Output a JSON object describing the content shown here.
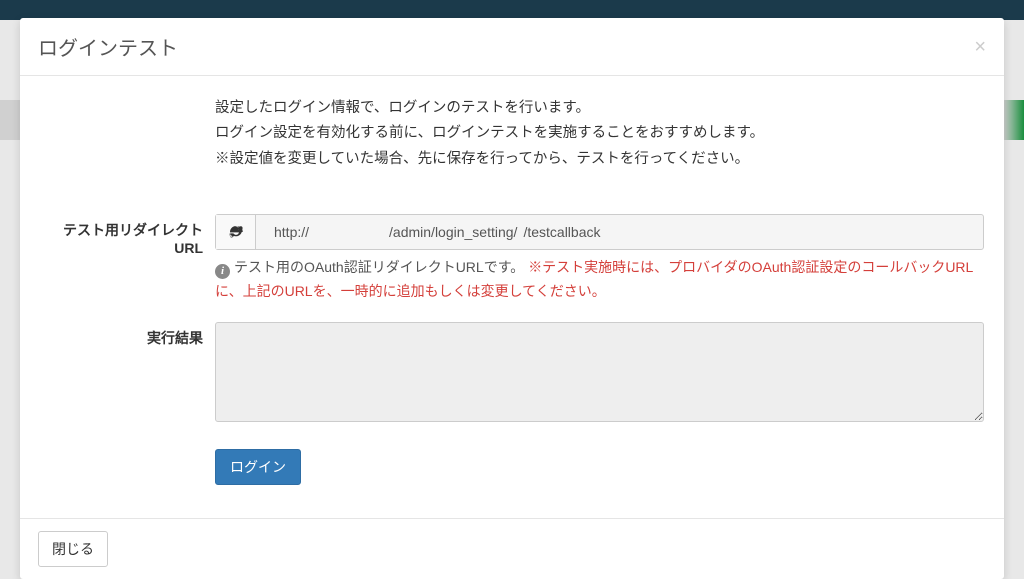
{
  "modal": {
    "title": "ログインテスト",
    "close_x": "×",
    "intro": {
      "line1": "設定したログイン情報で、ログインのテストを行います。",
      "line2": "ログイン設定を有効化する前に、ログインテストを実施することをおすすめします。",
      "line3": "※設定値を変更していた場合、先に保存を行ってから、テストを行ってください。"
    },
    "redirect": {
      "label": "テスト用リダイレクトURL",
      "url_part1": "http://",
      "url_part2": "/admin/login_setting/",
      "url_part3": "/testcallback",
      "help_prefix": "テスト用のOAuth認証リダイレクトURLです。",
      "help_warn": "※テスト実施時には、プロバイダのOAuth認証設定のコールバックURLに、上記のURLを、一時的に追加もしくは変更してください。"
    },
    "result": {
      "label": "実行結果",
      "value": ""
    },
    "login_button": "ログイン",
    "close_button": "閉じる"
  }
}
